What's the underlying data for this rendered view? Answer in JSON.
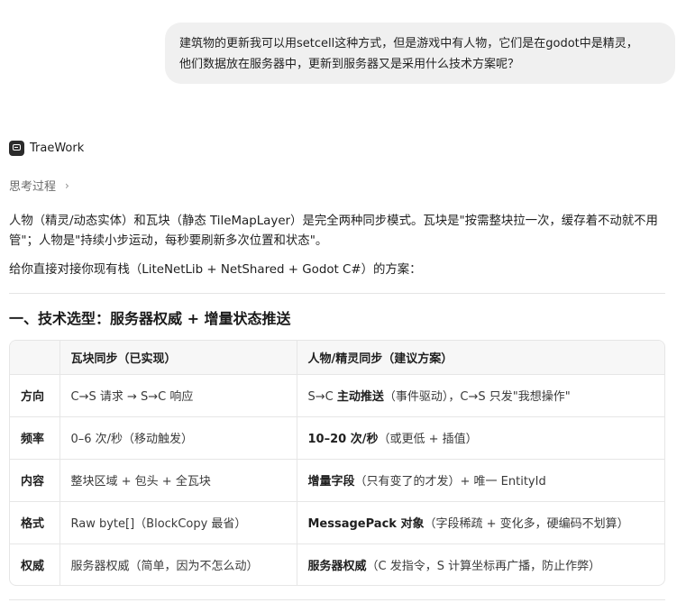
{
  "user_message": {
    "line1": "建筑物的更新我可以用setcell这种方式，但是游戏中有人物，它们是在godot中是精灵，",
    "line2": "他们数据放在服务器中，更新到服务器又是采用什么技术方案呢？"
  },
  "assistant": {
    "name": "TraeWork",
    "thinking_label": "思考过程",
    "paragraphs": [
      "人物（精灵/动态实体）和瓦块（静态 TileMapLayer）是完全两种同步模式。瓦块是\"按需整块拉一次，缓存着不动就不用管\"；人物是\"持续小步运动，每秒要刷新多次位置和状态\"。",
      "给你直接对接你现有栈（LiteNetLib + NetShared + Godot C#）的方案："
    ],
    "section_title": "一、技术选型：服务器权威 + 增量状态推送"
  },
  "table": {
    "headers": [
      "",
      "瓦块同步（已实现）",
      "人物/精灵同步（建议方案）"
    ],
    "rows": [
      {
        "label": "方向",
        "left": "C→S 请求 → S→C 响应",
        "right_strong": "",
        "right_pre": "S→C ",
        "right_bold_mid": "主动推送",
        "right_rest": "（事件驱动），C→S 只发\"我想操作\""
      },
      {
        "label": "频率",
        "left": "0–6 次/秒（移动触发）",
        "right_strong": "10–20 次/秒",
        "right_pre": "",
        "right_bold_mid": "",
        "right_rest": "（或更低 + 插值）"
      },
      {
        "label": "内容",
        "left": "整块区域 + 包头 + 全瓦块",
        "right_strong": "增量字段",
        "right_pre": "",
        "right_bold_mid": "",
        "right_rest": "（只有变了的才发）+ 唯一 EntityId"
      },
      {
        "label": "格式",
        "left": "Raw byte[]（BlockCopy 最省）",
        "right_strong": "MessagePack 对象",
        "right_pre": "",
        "right_bold_mid": "",
        "right_rest": "（字段稀疏 + 变化多，硬编码不划算）"
      },
      {
        "label": "权威",
        "left": "服务器权威（简单，因为不怎么动）",
        "right_strong": "服务器权威",
        "right_pre": "",
        "right_bold_mid": "",
        "right_rest": "（C 发指令，S 计算坐标再广播，防止作弊）"
      }
    ]
  },
  "colors": {
    "bubble_bg": "#f0f0f0",
    "text": "#1f1f1f",
    "muted": "#6b6b6b",
    "border": "#e6e6e6",
    "header_bg": "#f7f7f7"
  },
  "icons": {
    "app": "traework-logo-icon",
    "chevron": "chevron-right-icon"
  }
}
